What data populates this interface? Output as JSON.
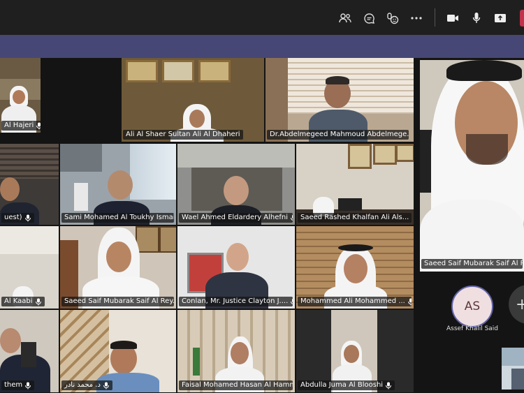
{
  "toolbar": {
    "icons": [
      "people-icon",
      "chat-icon",
      "reactions-icon",
      "more-icon",
      "camera-icon",
      "mic-icon",
      "share-icon",
      "leave-button"
    ],
    "colors": {
      "leave": "#c4314b",
      "banner": "#464775"
    }
  },
  "participants": [
    {
      "name": "Al Hajeri",
      "mic": true
    },
    {
      "name": "Ali Al Shaer Sultan Ali Al Dhaheri",
      "mic": false
    },
    {
      "name": "Dr.Abdelmegeed Mahmoud Abdelmege...",
      "mic": false
    },
    {
      "name": "uest)",
      "mic": true
    },
    {
      "name": "Sami Mohamed Al Toukhy Ismail",
      "mic": false
    },
    {
      "name": "Wael Ahmed Eldardery Alhefni",
      "mic": true
    },
    {
      "name": "Saeed Rashed Khalfan Ali Als...",
      "mic": true
    },
    {
      "name": "Al Kaabi",
      "mic": true
    },
    {
      "name": "Saeed Saif Mubarak Saif Al Rey...",
      "mic": true
    },
    {
      "name": "Conlan, Mr. Justice Clayton J....",
      "mic": true
    },
    {
      "name": "Mohammed Ali Mohammed ...",
      "mic": true
    },
    {
      "name": "them",
      "mic": true
    },
    {
      "name": "د. محمد نادر",
      "mic": true
    },
    {
      "name": "Faisal Mohamed Hasan Al Hammadi",
      "mic": true
    },
    {
      "name": "Abdulla Juma Al Blooshi",
      "mic": true
    },
    {
      "name": "Saeed Saif Mubarak Saif Al Reyami",
      "mic": true
    }
  ],
  "avatar": {
    "initials": "AS",
    "name": "Assef Khalil Said"
  },
  "overflow": {
    "label": "+"
  }
}
